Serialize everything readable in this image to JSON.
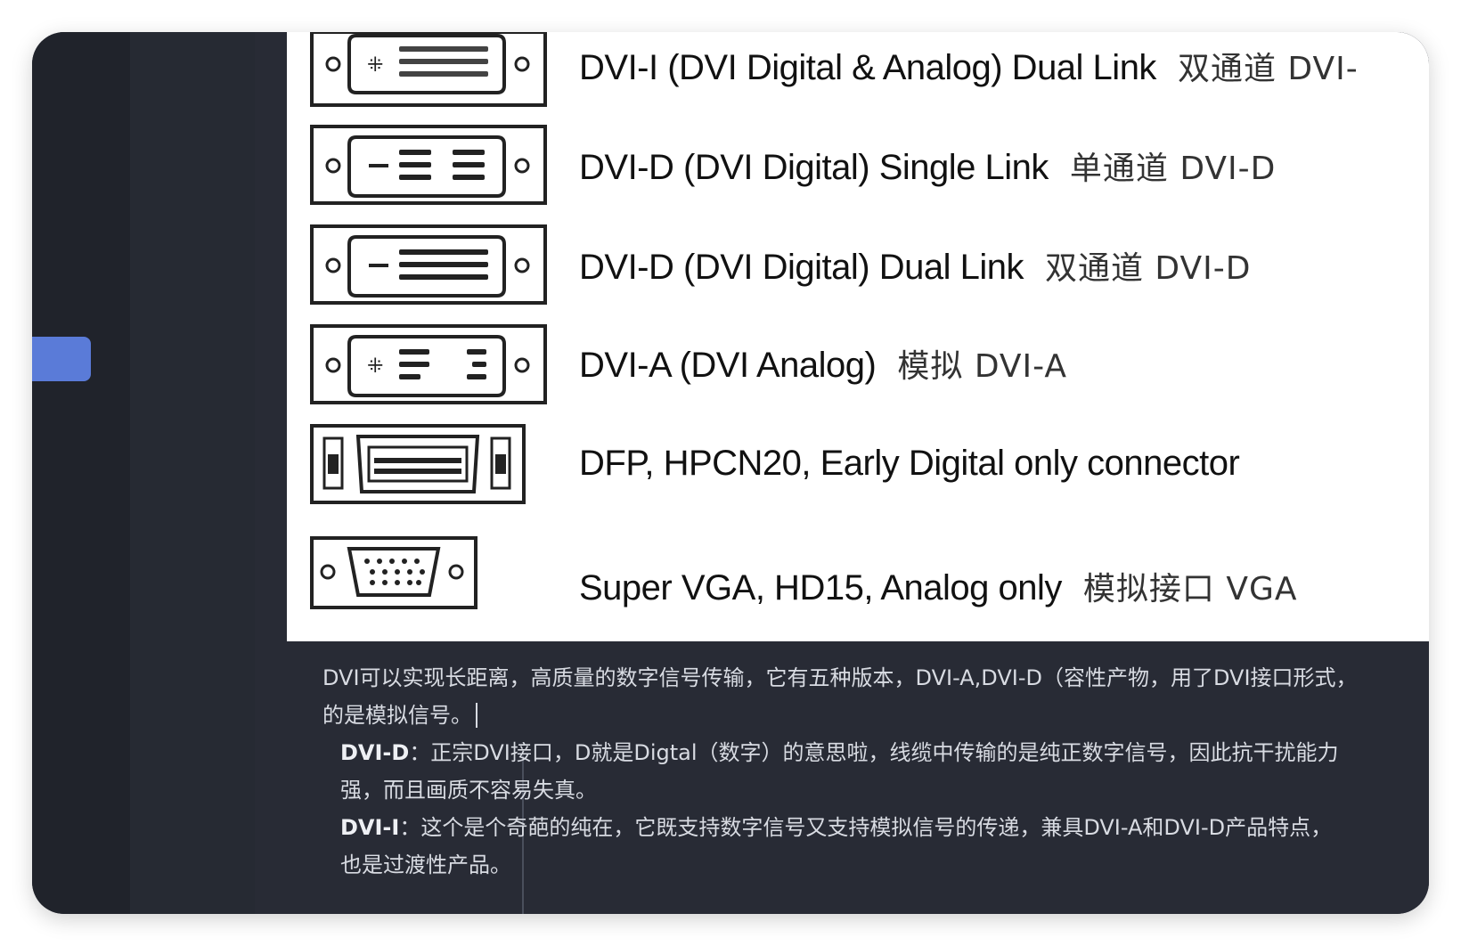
{
  "figure": {
    "rows": [
      {
        "label": "DVI-I (DVI Digital & Analog) Dual Link",
        "cn": "双通道 DVI-",
        "connector_icon": "dvi-i-dual-connector-icon"
      },
      {
        "label": "DVI-D (DVI Digital) Single Link",
        "cn": "单通道 DVI-D",
        "connector_icon": "dvi-d-single-connector-icon"
      },
      {
        "label": "DVI-D (DVI Digital) Dual Link",
        "cn": "双通道 DVI-D",
        "connector_icon": "dvi-d-dual-connector-icon"
      },
      {
        "label": "DVI-A (DVI Analog)",
        "cn": "模拟 DVI-A",
        "connector_icon": "dvi-a-connector-icon"
      },
      {
        "label": "DFP, HPCN20, Early Digital only connector",
        "cn": "",
        "connector_icon": "dfp-connector-icon"
      },
      {
        "label": "Super VGA, HD15, Analog only",
        "cn": "模拟接口 VGA",
        "connector_icon": "vga-connector-icon"
      }
    ]
  },
  "notes": {
    "item1": {
      "line1": "DVI可以实现长距离，高质量的数字信号传输，它有五种版本，DVI-A,DVI-D（容性产物，用了DVI接口形式，",
      "line2": "的是模拟信号。"
    },
    "item2": {
      "bold": "DVI-D",
      "line1": "：正宗DVI接口，D就是Digtal（数字）的意思啦，线缆中传输的是纯正数字信号，因此抗干扰能力",
      "line2": "强，而且画质不容易失真。"
    },
    "item3": {
      "bold": "DVI-I",
      "line1": "：这个是个奇葩的纯在，它既支持数字信号又支持模拟信号的传递，兼具DVI-A和DVI-D产品特点，",
      "line2": "也是过渡性产品。"
    }
  },
  "colors": {
    "rail_bg": "#20232b",
    "sidebar_bg": "#262a33",
    "editor_bg": "#282b35",
    "accent": "#5a7bd8",
    "text": "#d8dbe2"
  }
}
